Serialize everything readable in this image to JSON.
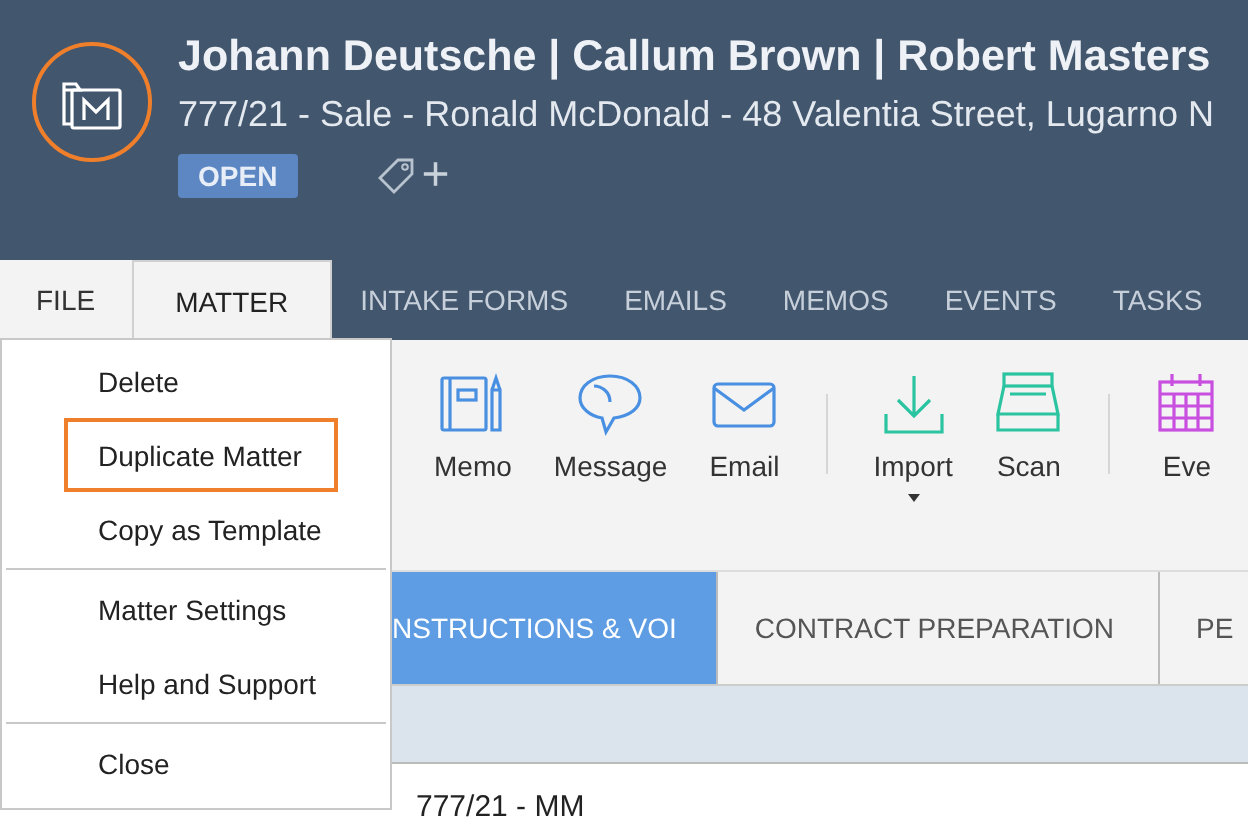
{
  "header": {
    "title": "Johann Deutsche | Callum Brown | Robert Masters",
    "subtitle": "777/21 - Sale - Ronald McDonald - 48 Valentia Street, Lugarno N",
    "status": "OPEN",
    "add_tag": "+"
  },
  "tabs": [
    {
      "label": "FILE",
      "kind": "file",
      "selected": false
    },
    {
      "label": "MATTER",
      "kind": "tab",
      "selected": true
    },
    {
      "label": "INTAKE FORMS",
      "kind": "tab",
      "selected": false
    },
    {
      "label": "EMAILS",
      "kind": "tab",
      "selected": false
    },
    {
      "label": "MEMOS",
      "kind": "tab",
      "selected": false
    },
    {
      "label": "EVENTS",
      "kind": "tab",
      "selected": false
    },
    {
      "label": "TASKS",
      "kind": "tab",
      "selected": false
    }
  ],
  "ribbon": [
    {
      "kind": "button",
      "label": "Memo",
      "dropdown": false
    },
    {
      "kind": "button",
      "label": "Message",
      "dropdown": false
    },
    {
      "kind": "button",
      "label": "Email",
      "dropdown": false
    },
    {
      "kind": "separator"
    },
    {
      "kind": "button",
      "label": "Import",
      "dropdown": true
    },
    {
      "kind": "button",
      "label": "Scan",
      "dropdown": false
    },
    {
      "kind": "separator"
    },
    {
      "kind": "button",
      "label": "Eve",
      "dropdown": false
    }
  ],
  "stages": [
    {
      "label": "NSTRUCTIONS & VOI",
      "selected": true
    },
    {
      "label": "CONTRACT PREPARATION",
      "selected": false
    },
    {
      "label": "PE",
      "selected": false
    }
  ],
  "info": {
    "value": "777/21 - MM"
  },
  "menu": [
    {
      "kind": "item",
      "label": "Delete",
      "highlighted": false
    },
    {
      "kind": "item",
      "label": "Duplicate Matter",
      "highlighted": true
    },
    {
      "kind": "item",
      "label": "Copy as Template",
      "highlighted": false
    },
    {
      "kind": "separator"
    },
    {
      "kind": "item",
      "label": "Matter Settings",
      "highlighted": false
    },
    {
      "kind": "item",
      "label": "Help and Support",
      "highlighted": false
    },
    {
      "kind": "separator"
    },
    {
      "kind": "item",
      "label": "Close",
      "highlighted": false
    }
  ]
}
